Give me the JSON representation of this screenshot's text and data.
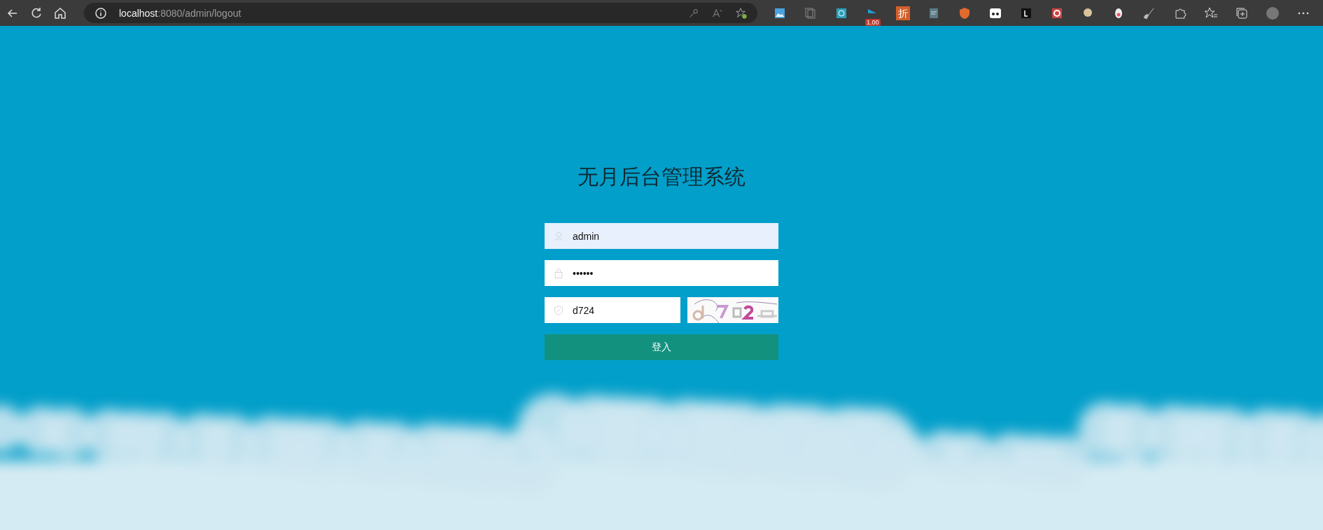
{
  "browser": {
    "url_host": "localhost",
    "url_rest": ":8080/admin/logout",
    "extension_badge": "1.00",
    "extension_glyph": "折"
  },
  "login": {
    "title": "无月后台管理系统",
    "fields": [
      {
        "kind": "user",
        "value": "admin"
      },
      {
        "kind": "password",
        "value": "••••••"
      },
      {
        "kind": "captcha",
        "value": "d724"
      }
    ],
    "button": "登入"
  }
}
